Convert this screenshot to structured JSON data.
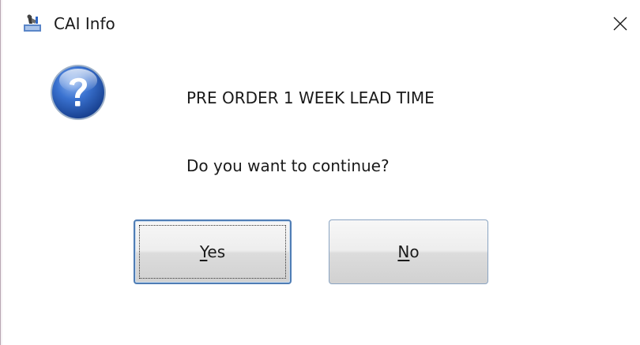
{
  "window": {
    "title": "CAI Info",
    "app_icon": "app-icon",
    "close_icon": "close-icon"
  },
  "dialog": {
    "icon": "question-icon",
    "message": "PRE ORDER 1 WEEK LEAD TIME",
    "question": "Do you want to continue?"
  },
  "buttons": {
    "yes": {
      "access_key": "Y",
      "rest": "es",
      "label": "Yes",
      "focused": true
    },
    "no": {
      "access_key": "N",
      "rest": "o",
      "label": "No",
      "focused": false
    }
  },
  "colors": {
    "icon_blue": "#2f66c4",
    "button_border_focus": "#4f7db5",
    "button_border": "#8aa4c2"
  }
}
